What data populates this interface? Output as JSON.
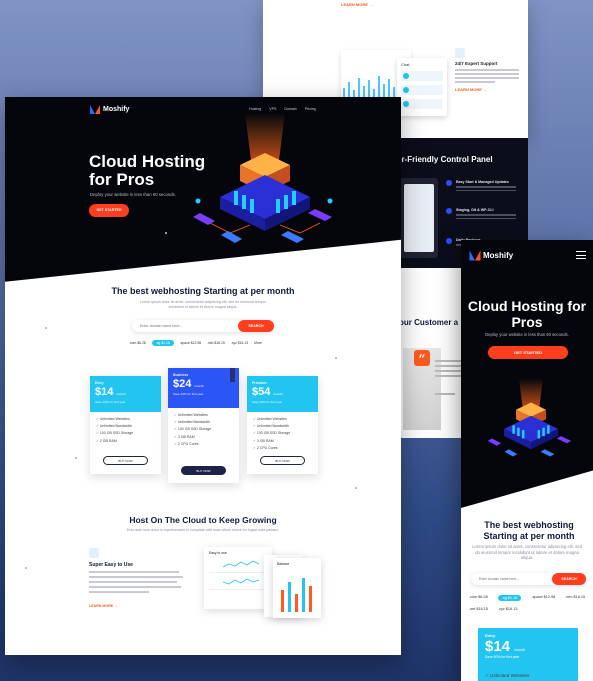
{
  "back_page": {
    "learn_more": "LEARN MORE →",
    "support_title": "24/7 Expert Support",
    "support_more": "LEARN MORE →",
    "card_title": "Chat"
  },
  "mid_page": {
    "title": "er-Friendly Control Panel",
    "features": [
      "Easy Start & Managed Updates",
      "Staging, Git & WP-CLI",
      "Daily Backups"
    ]
  },
  "testimonial": {
    "title": "our Customer a"
  },
  "desktop": {
    "brand": "Moshify",
    "nav": [
      "Hosting",
      "VPS",
      "Domain",
      "Pricing"
    ],
    "hero_title": "Cloud Hosting for Pros",
    "hero_sub": "Deploy your website in less than 60 seconds.",
    "hero_cta": "GET STARTED",
    "section1_title": "The best webhosting Starting at per month",
    "section1_desc": "Lorem ipsum dolor sit amet, consectetur adipiscing elit, sed do eiusmod tempor incididunt ut labore et dolore magna aliqua.",
    "search_placeholder": "Enter domain name here...",
    "search_button": "SEARCH",
    "tlds": [
      ".com $6.28",
      ".sg $1.18",
      ".space $12.98",
      ".info $18.15",
      ".xyz $16.13",
      "More"
    ],
    "plans": [
      {
        "name": "Entry",
        "price": "$14",
        "per": "/month",
        "note": "Save 40% for first year",
        "features": [
          "Unlimited Websites",
          "Unlimited Bandwidth",
          "100 GB SSD Storage",
          "2 GB RAM"
        ],
        "button": "BUY NOW"
      },
      {
        "name": "Business",
        "price": "$24",
        "per": "/month",
        "note": "Save 40% for first year",
        "features": [
          "Unlimited Websites",
          "Unlimited Bandwidth",
          "100 GB SSD Storage",
          "3 GB RAM",
          "2 CPU Cores"
        ],
        "button": "BUY NOW"
      },
      {
        "name": "Premium",
        "price": "$54",
        "per": "/month",
        "note": "Save 40% for first year",
        "features": [
          "Unlimited Websites",
          "Unlimited Bandwidth",
          "100 GB SSD Storage",
          "3 GB RAM",
          "2 CPU Cores"
        ],
        "button": "BUY NOW"
      }
    ],
    "section2_title": "Host On The Cloud to Keep Growing",
    "section2_desc": "Duis aute irure dolor in reprehenderit in voluptate velit esse cillum dolore eu fugiat nulla pariatur.",
    "easy_title": "Super Easy to Use",
    "easy_more": "LEARN MORE →",
    "panel_a_title": "Easy to use",
    "panel_c_title": "Balance"
  },
  "mobile": {
    "brand": "Moshify",
    "hero_title": "Cloud Hosting for Pros",
    "hero_sub": "Deploy your website in less than 60 seconds.",
    "hero_cta": "GET STARTED",
    "section_title": "The best webhosting Starting at per month",
    "section_desc": "Lorem ipsum dolor sit amet, consectetur adipiscing elit, sed do eiusmod tempor incididunt ut labore et dolore magna aliqua.",
    "search_placeholder": "Enter domain name here...",
    "search_button": "SEARCH",
    "tlds": [
      ".com $6.28",
      ".sg $1.18",
      ".space $12.98",
      ".info $18.15",
      ".net $16.15",
      ".xyz $16.13"
    ],
    "plan_name": "Entry",
    "plan_price": "$14",
    "plan_per": "/month",
    "plan_note": "Save 40% for first year",
    "plan_feature": "✓ Unlimited Websites"
  },
  "colors": {
    "accent": "#ff3d1f",
    "cyan": "#22c5f0",
    "featured": "#2b55f5",
    "dark": "#05060b"
  }
}
